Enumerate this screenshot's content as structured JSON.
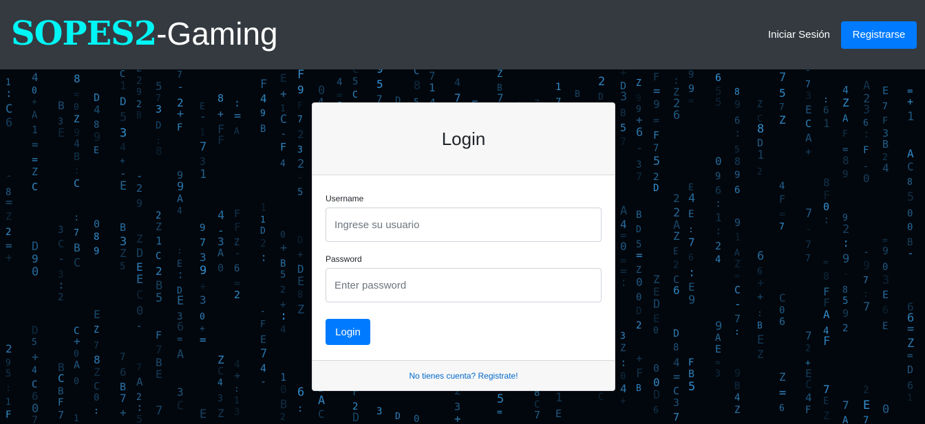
{
  "navbar": {
    "brand_accent": "SOPES2",
    "brand_rest": "-Gaming",
    "login_link": "Iniciar Sesión",
    "register_button": "Registrarse"
  },
  "login_card": {
    "title": "Login",
    "username_label": "Username",
    "username_placeholder": "Ingrese su usuario",
    "username_value": "",
    "password_label": "Password",
    "password_placeholder": "Enter password",
    "password_value": "",
    "submit_label": "Login",
    "footer_link": "No tienes cuenta? Registrate!"
  },
  "background": {
    "style": "matrix-digital-rain",
    "glyphs": "0123456789ABCDEFZ7=-:+"
  },
  "colors": {
    "navbar_bg": "#343a40",
    "brand_accent": "#00f5f5",
    "primary": "#007bff",
    "link": "#0068c9",
    "matrix_glyph": "#3aa0e8"
  },
  "icons": {}
}
